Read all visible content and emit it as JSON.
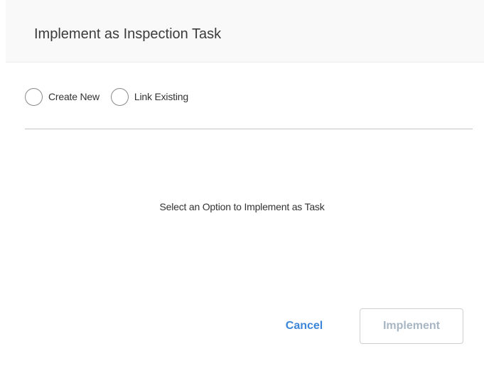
{
  "dialog": {
    "title": "Implement as Inspection Task"
  },
  "options": [
    {
      "label": "Create New",
      "selected": false
    },
    {
      "label": "Link Existing",
      "selected": false
    }
  ],
  "message": "Select an Option to Implement as Task",
  "actions": {
    "cancel_label": "Cancel",
    "implement_label": "Implement",
    "implement_enabled": false
  },
  "colors": {
    "link_blue": "#3b86d8",
    "disabled_text": "#a8b6c4",
    "header_bg": "#f9f9f9"
  }
}
